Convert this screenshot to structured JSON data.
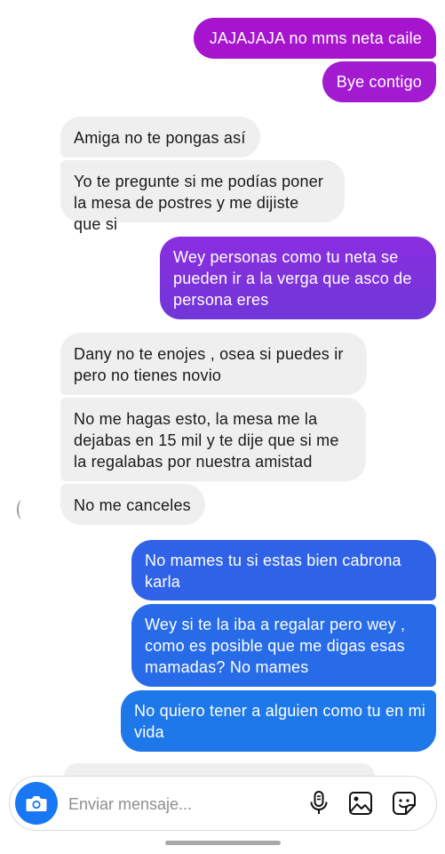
{
  "thread": {
    "messages": [
      {
        "id": "m1",
        "direction": "sent",
        "text": "JAJAJAJA no mms neta caile"
      },
      {
        "id": "m2",
        "direction": "sent",
        "text": "Bye contigo"
      },
      {
        "id": "m3",
        "direction": "received",
        "text": "Amiga no te pongas así"
      },
      {
        "id": "m4",
        "direction": "received",
        "text": "Yo te pregunte si me podías poner la mesa de postres y me dijiste que si"
      },
      {
        "id": "m5",
        "direction": "sent",
        "text": "Wey personas como tu neta se pueden ir a la verga que asco de persona eres"
      },
      {
        "id": "m6",
        "direction": "received",
        "text": "Dany no te enojes , osea si puedes ir pero no tienes novio"
      },
      {
        "id": "m7",
        "direction": "received",
        "text": "No me hagas esto,  la mesa me la dejabas en 15 mil y te dije que si me la regalabas por nuestra amistad"
      },
      {
        "id": "m8",
        "direction": "received",
        "text": "No me canceles"
      },
      {
        "id": "m9",
        "direction": "sent",
        "text": "No mames tu si estas bien cabrona karla"
      },
      {
        "id": "m10",
        "direction": "sent",
        "text": "Wey si te la iba a regalar pero wey , como es posible que me digas esas mamadas? No mames"
      },
      {
        "id": "m11",
        "direction": "sent",
        "text": "No quiero  tener a alguien como tu en mi vida"
      }
    ]
  },
  "composer": {
    "placeholder": "Enviar mensaje...",
    "value": "",
    "icons": {
      "camera": "camera-icon",
      "mic": "microphone-icon",
      "gallery": "gallery-icon",
      "sticker": "sticker-icon"
    }
  },
  "colors": {
    "sent_purple": "#a614ce",
    "sent_violet": "#7136d8",
    "sent_blue": "#276be8",
    "received_gray": "#efefef",
    "camera_blue": "#1877f2"
  }
}
